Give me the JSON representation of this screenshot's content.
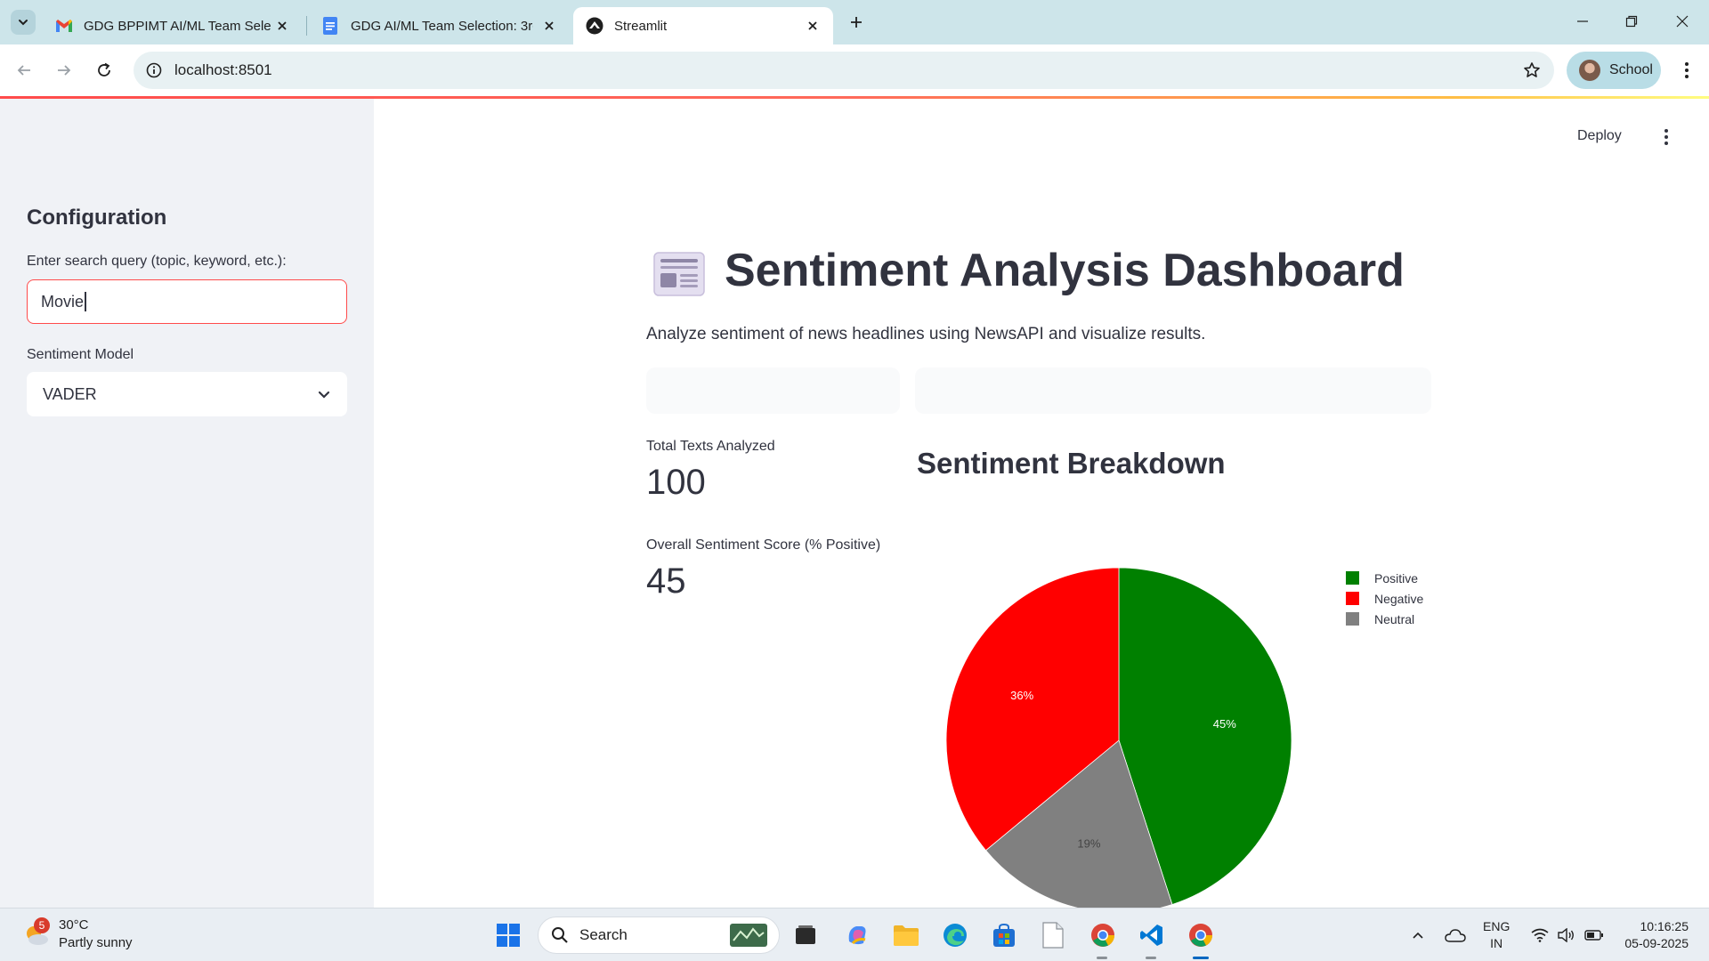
{
  "browser": {
    "tabs": [
      {
        "title": "GDG BPPIMT AI/ML Team Selec",
        "icon": "gmail-icon"
      },
      {
        "title": "GDG AI/ML Team Selection: 3rd",
        "icon": "docs-icon"
      },
      {
        "title": "Streamlit",
        "icon": "streamlit-icon",
        "active": true
      }
    ],
    "url": "localhost:8501",
    "profile_name": "School"
  },
  "app": {
    "deploy_label": "Deploy",
    "sidebar": {
      "heading": "Configuration",
      "query_label": "Enter search query (topic, keyword, etc.):",
      "query_value": "Movie",
      "model_label": "Sentiment Model",
      "model_value": "VADER"
    },
    "title": "Sentiment Analysis Dashboard",
    "subtitle": "Analyze sentiment of news headlines using NewsAPI and visualize results.",
    "metrics": [
      {
        "label": "Total Texts Analyzed",
        "value": "100"
      },
      {
        "label": "Overall Sentiment Score (% Positive)",
        "value": "45"
      }
    ],
    "breakdown_title": "Sentiment Breakdown"
  },
  "chart_data": {
    "type": "pie",
    "categories": [
      "Positive",
      "Negative",
      "Neutral"
    ],
    "values": [
      45,
      36,
      19
    ],
    "labels": [
      "45%",
      "36%",
      "19%"
    ],
    "colors": [
      "#008000",
      "#ff0000",
      "#808080"
    ],
    "legend_position": "top-right"
  },
  "taskbar": {
    "weather_temp": "30°C",
    "weather_desc": "Partly sunny",
    "weather_badge": "5",
    "search_label": "Search",
    "lang_top": "ENG",
    "lang_bottom": "IN",
    "time": "10:16:25",
    "date": "05-09-2025"
  }
}
